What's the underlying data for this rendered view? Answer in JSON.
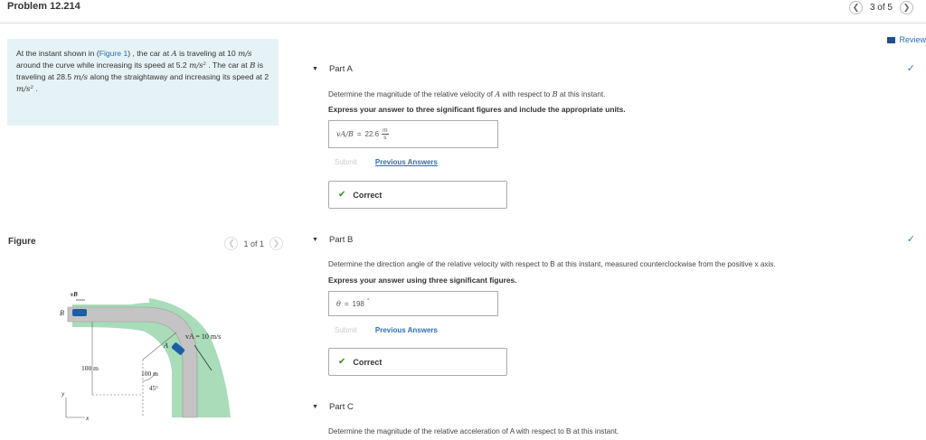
{
  "header": {
    "title": "Problem 12.214",
    "pager_text": "3 of 5"
  },
  "prompt": {
    "p1": "At the instant shown in (",
    "figure_link": "Figure 1",
    "p2": ") , the car at ",
    "car_a": "A",
    "p3": " is traveling at 10 ",
    "unit_ms": "m/s",
    "p4": " around the curve while increasing its speed at 5.2 ",
    "unit_ms2": "m/s²",
    "p5": " . The car at ",
    "car_b": "B",
    "p6": " is traveling at 28.5 ",
    "unit_ms_b": "m/s",
    "p7": " along the straightaway and increasing its speed at 2 ",
    "unit_ms2_b": "m/s²",
    "p8": " ."
  },
  "figure": {
    "title": "Figure",
    "pager": "1 of 1",
    "labels": {
      "vb": "vB",
      "b": "B",
      "a": "A",
      "va": "vA = 10 m/s",
      "r1": "100 m",
      "r2": "100 m",
      "angle": "45°",
      "y": "y",
      "x": "x"
    }
  },
  "review": {
    "label": "Review"
  },
  "parts": {
    "a": {
      "label": "Part A",
      "question_pre": "Determine the magnitude of the relative velocity of ",
      "question_var1": "A",
      "question_mid": " with respect to ",
      "question_var2": "B",
      "question_post": " at this instant.",
      "instruction": "Express your answer to three significant figures and include the appropriate units.",
      "answer_var": "vA/B",
      "answer_value": "22.6",
      "answer_unit_num": "m",
      "answer_unit_den": "s",
      "submit": "Submit",
      "previous": "Previous Answers",
      "status": "Correct"
    },
    "b": {
      "label": "Part B",
      "question": "Determine the direction angle of the relative velocity with respect to B at this instant, measured counterclockwise from the positive x axis.",
      "instruction": "Express your answer using three significant figures.",
      "answer_var": "θ",
      "answer_value": "198",
      "answer_unit": "°",
      "submit": "Submit",
      "previous": "Previous Answers",
      "status": "Correct"
    },
    "c": {
      "label": "Part C",
      "question": "Determine the magnitude of the relative acceleration of A with respect to B at this instant."
    }
  },
  "colors": {
    "accent": "#2b6fb7",
    "prompt_bg": "#e6f3f6",
    "road": "#b9b9b9",
    "grass": "#a9dcb8",
    "correct_green": "#3a8a2a"
  }
}
